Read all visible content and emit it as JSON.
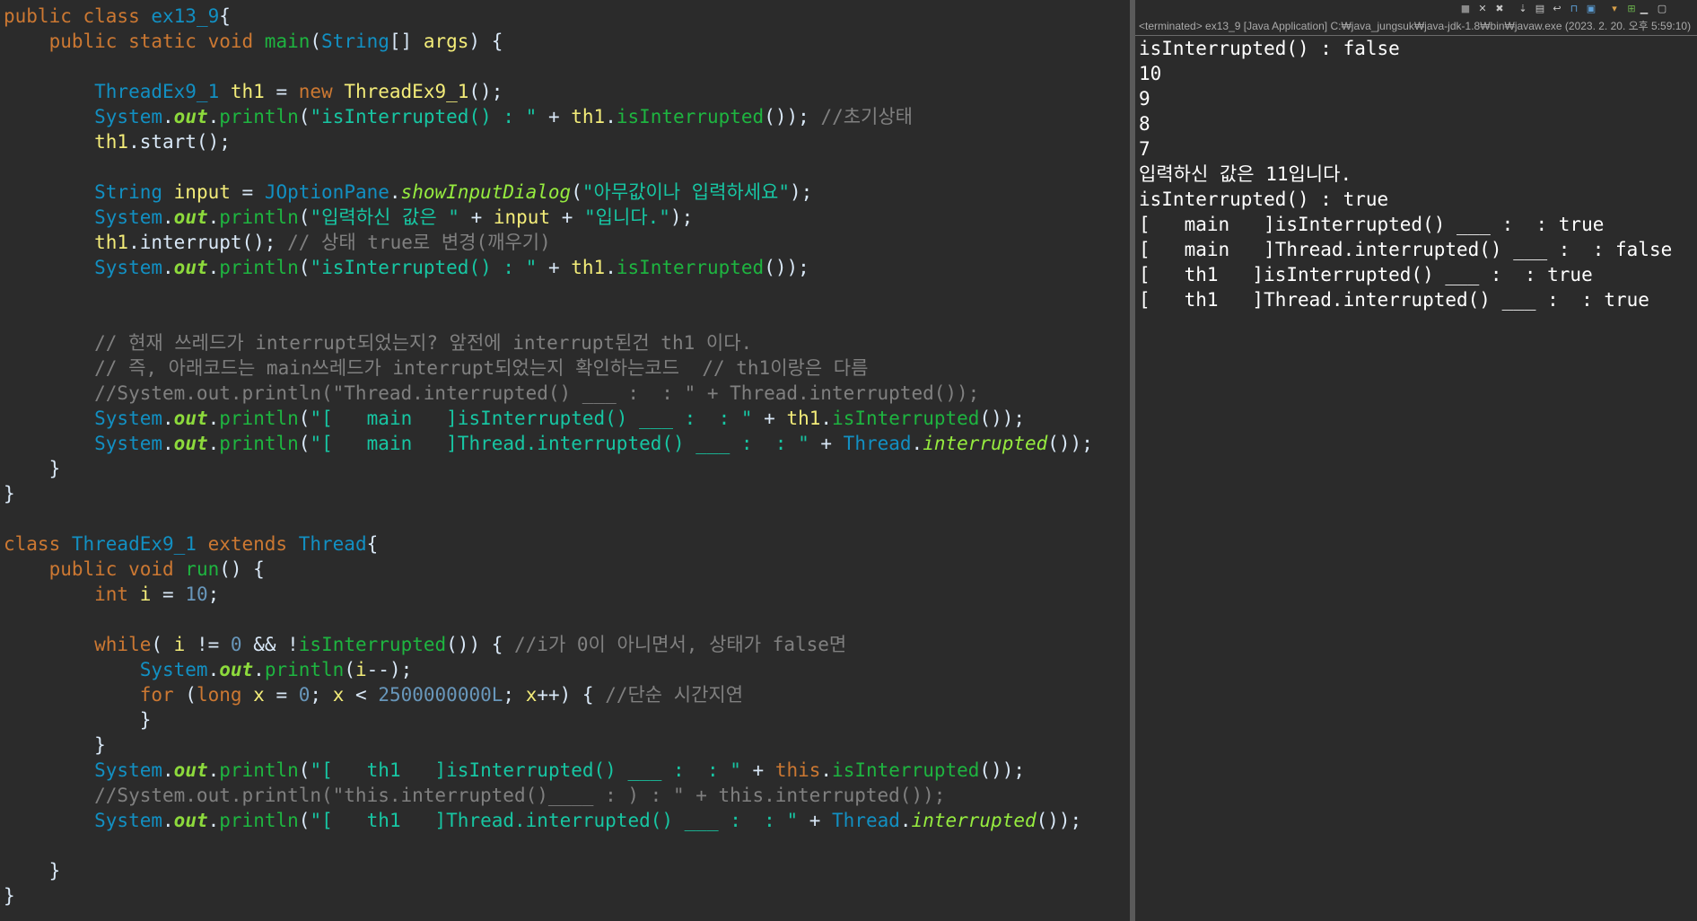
{
  "editor": {
    "lines": [
      [
        {
          "t": "public class ",
          "c": "kw"
        },
        {
          "t": "ex13_9",
          "c": "ty"
        },
        {
          "t": "{",
          "c": "pl"
        }
      ],
      [
        {
          "t": "    public static void ",
          "c": "kw"
        },
        {
          "t": "main",
          "c": "mt"
        },
        {
          "t": "(",
          "c": "pl"
        },
        {
          "t": "String",
          "c": "ty"
        },
        {
          "t": "[] ",
          "c": "pl"
        },
        {
          "t": "args",
          "c": "vr"
        },
        {
          "t": ") {",
          "c": "pl"
        }
      ],
      [],
      [
        {
          "t": "        ThreadEx9_1 ",
          "c": "ty"
        },
        {
          "t": "th1",
          "c": "vr"
        },
        {
          "t": " = ",
          "c": "pl"
        },
        {
          "t": "new ",
          "c": "kw"
        },
        {
          "t": "ThreadEx9_1",
          "c": "vr"
        },
        {
          "t": "();",
          "c": "pl"
        }
      ],
      [
        {
          "t": "        System",
          "c": "ty"
        },
        {
          "t": ".",
          "c": "pl"
        },
        {
          "t": "out",
          "c": "fd"
        },
        {
          "t": ".",
          "c": "pl"
        },
        {
          "t": "println",
          "c": "mt"
        },
        {
          "t": "(",
          "c": "pl"
        },
        {
          "t": "\"isInterrupted() : \"",
          "c": "st"
        },
        {
          "t": " + ",
          "c": "pl"
        },
        {
          "t": "th1",
          "c": "vr"
        },
        {
          "t": ".",
          "c": "pl"
        },
        {
          "t": "isInterrupted",
          "c": "mt"
        },
        {
          "t": "()); ",
          "c": "pl"
        },
        {
          "t": "//초기상태",
          "c": "cm"
        }
      ],
      [
        {
          "t": "        th1",
          "c": "vr"
        },
        {
          "t": ".start();",
          "c": "pl"
        }
      ],
      [],
      [
        {
          "t": "        String ",
          "c": "ty"
        },
        {
          "t": "input",
          "c": "vr"
        },
        {
          "t": " = ",
          "c": "pl"
        },
        {
          "t": "JOptionPane",
          "c": "ty"
        },
        {
          "t": ".",
          "c": "pl"
        },
        {
          "t": "showInputDialog",
          "c": "im"
        },
        {
          "t": "(",
          "c": "pl"
        },
        {
          "t": "\"아무값이나 입력하세요\"",
          "c": "st"
        },
        {
          "t": ");",
          "c": "pl"
        }
      ],
      [
        {
          "t": "        System",
          "c": "ty"
        },
        {
          "t": ".",
          "c": "pl"
        },
        {
          "t": "out",
          "c": "fd"
        },
        {
          "t": ".",
          "c": "pl"
        },
        {
          "t": "println",
          "c": "mt"
        },
        {
          "t": "(",
          "c": "pl"
        },
        {
          "t": "\"입력하신 값은 \"",
          "c": "st"
        },
        {
          "t": " + ",
          "c": "pl"
        },
        {
          "t": "input",
          "c": "vr"
        },
        {
          "t": " + ",
          "c": "pl"
        },
        {
          "t": "\"입니다.\"",
          "c": "st"
        },
        {
          "t": ");",
          "c": "pl"
        }
      ],
      [
        {
          "t": "        th1",
          "c": "vr"
        },
        {
          "t": ".interrupt(); ",
          "c": "pl"
        },
        {
          "t": "// 상태 true로 변경(깨우기)",
          "c": "cm"
        }
      ],
      [
        {
          "t": "        System",
          "c": "ty"
        },
        {
          "t": ".",
          "c": "pl"
        },
        {
          "t": "out",
          "c": "fd"
        },
        {
          "t": ".",
          "c": "pl"
        },
        {
          "t": "println",
          "c": "mt"
        },
        {
          "t": "(",
          "c": "pl"
        },
        {
          "t": "\"isInterrupted() : \"",
          "c": "st"
        },
        {
          "t": " + ",
          "c": "pl"
        },
        {
          "t": "th1",
          "c": "vr"
        },
        {
          "t": ".",
          "c": "pl"
        },
        {
          "t": "isInterrupted",
          "c": "mt"
        },
        {
          "t": "());",
          "c": "pl"
        }
      ],
      [],
      [],
      [
        {
          "t": "        // 현재 쓰레드가 interrupt되었는지? 앞전에 interrupt된건 th1 이다.",
          "c": "cm"
        }
      ],
      [
        {
          "t": "        // 즉, 아래코드는 main쓰레드가 interrupt되었는지 확인하는코드  // th1이랑은 다름",
          "c": "cm"
        }
      ],
      [
        {
          "t": "        //System.out.println(\"Thread.interrupted() ___ :  : \" + Thread.interrupted());",
          "c": "cm"
        }
      ],
      [
        {
          "t": "        System",
          "c": "ty"
        },
        {
          "t": ".",
          "c": "pl"
        },
        {
          "t": "out",
          "c": "fd"
        },
        {
          "t": ".",
          "c": "pl"
        },
        {
          "t": "println",
          "c": "mt"
        },
        {
          "t": "(",
          "c": "pl"
        },
        {
          "t": "\"[   main   ]isInterrupted() ___ :  : \"",
          "c": "st"
        },
        {
          "t": " + ",
          "c": "pl"
        },
        {
          "t": "th1",
          "c": "vr"
        },
        {
          "t": ".",
          "c": "pl"
        },
        {
          "t": "isInterrupted",
          "c": "mt"
        },
        {
          "t": "());",
          "c": "pl"
        }
      ],
      [
        {
          "t": "        System",
          "c": "ty"
        },
        {
          "t": ".",
          "c": "pl"
        },
        {
          "t": "out",
          "c": "fd"
        },
        {
          "t": ".",
          "c": "pl"
        },
        {
          "t": "println",
          "c": "mt"
        },
        {
          "t": "(",
          "c": "pl"
        },
        {
          "t": "\"[   main   ]Thread.interrupted() ___ :  : \"",
          "c": "st"
        },
        {
          "t": " + ",
          "c": "pl"
        },
        {
          "t": "Thread",
          "c": "ty"
        },
        {
          "t": ".",
          "c": "pl"
        },
        {
          "t": "interrupted",
          "c": "im"
        },
        {
          "t": "());",
          "c": "pl"
        }
      ],
      [
        {
          "t": "    }",
          "c": "pl"
        }
      ],
      [
        {
          "t": "}",
          "c": "pl"
        }
      ],
      [],
      [
        {
          "t": "class ",
          "c": "kw"
        },
        {
          "t": "ThreadEx9_1 ",
          "c": "ty"
        },
        {
          "t": "extends ",
          "c": "kw"
        },
        {
          "t": "Thread",
          "c": "ty"
        },
        {
          "t": "{",
          "c": "pl"
        }
      ],
      [
        {
          "t": "    public void ",
          "c": "kw"
        },
        {
          "t": "run",
          "c": "mt"
        },
        {
          "t": "() {",
          "c": "pl"
        }
      ],
      [
        {
          "t": "        int ",
          "c": "kw"
        },
        {
          "t": "i",
          "c": "vr"
        },
        {
          "t": " = ",
          "c": "pl"
        },
        {
          "t": "10",
          "c": "nm"
        },
        {
          "t": ";",
          "c": "pl"
        }
      ],
      [],
      [
        {
          "t": "        while",
          "c": "kw"
        },
        {
          "t": "( ",
          "c": "pl"
        },
        {
          "t": "i",
          "c": "vr"
        },
        {
          "t": " != ",
          "c": "pl"
        },
        {
          "t": "0",
          "c": "nm"
        },
        {
          "t": " && !",
          "c": "pl"
        },
        {
          "t": "isInterrupted",
          "c": "mt"
        },
        {
          "t": "()) { ",
          "c": "pl"
        },
        {
          "t": "//i가 0이 아니면서, 상태가 false면",
          "c": "cm"
        }
      ],
      [
        {
          "t": "            System",
          "c": "ty"
        },
        {
          "t": ".",
          "c": "pl"
        },
        {
          "t": "out",
          "c": "fd"
        },
        {
          "t": ".",
          "c": "pl"
        },
        {
          "t": "println",
          "c": "mt"
        },
        {
          "t": "(",
          "c": "pl"
        },
        {
          "t": "i",
          "c": "vr"
        },
        {
          "t": "--);",
          "c": "pl"
        }
      ],
      [
        {
          "t": "            for ",
          "c": "kw"
        },
        {
          "t": "(",
          "c": "pl"
        },
        {
          "t": "long ",
          "c": "kw"
        },
        {
          "t": "x",
          "c": "vr"
        },
        {
          "t": " = ",
          "c": "pl"
        },
        {
          "t": "0",
          "c": "nm"
        },
        {
          "t": "; ",
          "c": "pl"
        },
        {
          "t": "x",
          "c": "vr"
        },
        {
          "t": " < ",
          "c": "pl"
        },
        {
          "t": "2500000000L",
          "c": "nm"
        },
        {
          "t": "; ",
          "c": "pl"
        },
        {
          "t": "x",
          "c": "vr"
        },
        {
          "t": "++) { ",
          "c": "pl"
        },
        {
          "t": "//단순 시간지연",
          "c": "cm"
        }
      ],
      [
        {
          "t": "            }",
          "c": "pl"
        }
      ],
      [
        {
          "t": "        }",
          "c": "pl"
        }
      ],
      [
        {
          "t": "        System",
          "c": "ty"
        },
        {
          "t": ".",
          "c": "pl"
        },
        {
          "t": "out",
          "c": "fd"
        },
        {
          "t": ".",
          "c": "pl"
        },
        {
          "t": "println",
          "c": "mt"
        },
        {
          "t": "(",
          "c": "pl"
        },
        {
          "t": "\"[   th1   ]isInterrupted() ___ :  : \"",
          "c": "st"
        },
        {
          "t": " + ",
          "c": "pl"
        },
        {
          "t": "this",
          "c": "kw"
        },
        {
          "t": ".",
          "c": "pl"
        },
        {
          "t": "isInterrupted",
          "c": "mt"
        },
        {
          "t": "());",
          "c": "pl"
        }
      ],
      [
        {
          "t": "        //System.out.println(\"this.interrupted()____ : ) : \" + this.interrupted());",
          "c": "cm"
        }
      ],
      [
        {
          "t": "        System",
          "c": "ty"
        },
        {
          "t": ".",
          "c": "pl"
        },
        {
          "t": "out",
          "c": "fd"
        },
        {
          "t": ".",
          "c": "pl"
        },
        {
          "t": "println",
          "c": "mt"
        },
        {
          "t": "(",
          "c": "pl"
        },
        {
          "t": "\"[   th1   ]Thread.interrupted() ___ :  : \"",
          "c": "st"
        },
        {
          "t": " + ",
          "c": "pl"
        },
        {
          "t": "Thread",
          "c": "ty"
        },
        {
          "t": ".",
          "c": "pl"
        },
        {
          "t": "interrupted",
          "c": "im"
        },
        {
          "t": "());",
          "c": "pl"
        }
      ],
      [],
      [
        {
          "t": "    }",
          "c": "pl"
        }
      ],
      [
        {
          "t": "}",
          "c": "pl"
        }
      ]
    ]
  },
  "console": {
    "header": "<terminated> ex13_9 [Java Application] C:₩java_jungsuk₩java-jdk-1.8₩bin₩javaw.exe  (2023. 2. 20. 오후 5:59:10)",
    "toolbar_icons": [
      "stop-icon",
      "remove-launch-icon",
      "remove-all-terminated-icon",
      "scroll-lock-icon",
      "show-console-on-output-icon",
      "word-wrap-icon",
      "pin-console-icon",
      "display-selected-console-icon",
      "open-console-icon",
      "new-console-view-icon",
      "minimize-icon",
      "maximize-icon"
    ],
    "output": [
      "isInterrupted() : false",
      "10",
      "9",
      "8",
      "7",
      "입력하신 값은 11입니다.",
      "isInterrupted() : true",
      "[   main   ]isInterrupted() ___ :  : true",
      "[   main   ]Thread.interrupted() ___ :  : false",
      "[   th1   ]isInterrupted() ___ :  : true",
      "[   th1   ]Thread.interrupted() ___ :  : true"
    ]
  },
  "colors": {
    "background": "#2b2b2b",
    "keyword": "#cc7832",
    "type": "#1290c3",
    "method": "#1eb540",
    "string": "#17c6a3",
    "comment": "#808080",
    "field": "#8dda3c",
    "variable": "#f3ec79",
    "number": "#6897bb",
    "console_text": "#ffffff"
  }
}
